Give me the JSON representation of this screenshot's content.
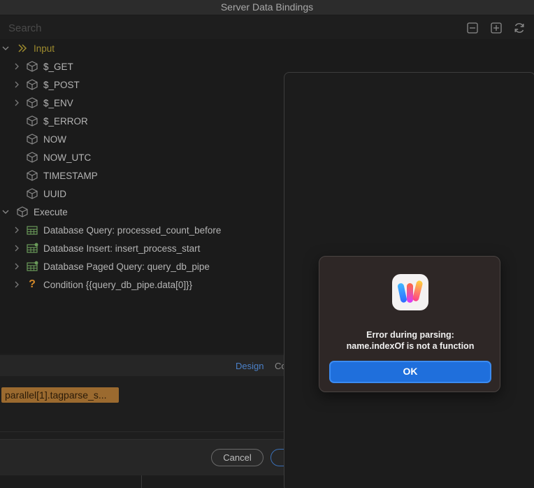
{
  "window": {
    "title": "Server Data Bindings"
  },
  "search": {
    "placeholder": "Search"
  },
  "toolbar": {
    "collapse_icon": "minus-square-icon",
    "expand_icon": "plus-square-icon",
    "refresh_icon": "refresh-icon"
  },
  "tree": {
    "input": {
      "label": "Input",
      "children": [
        "$_GET",
        "$_POST",
        "$_ENV",
        "$_ERROR",
        "NOW",
        "NOW_UTC",
        "TIMESTAMP",
        "UUID"
      ]
    },
    "execute": {
      "label": "Execute",
      "children": [
        "Database Query: processed_count_before",
        "Database Insert: insert_process_start",
        "Database Paged Query: query_db_pipe",
        "Condition {{query_db_pipe.data[0]}}"
      ]
    }
  },
  "tabs": {
    "design": "Design",
    "code": "Co"
  },
  "expression": {
    "chip": "parallel[1].tagparse_s..."
  },
  "footer": {
    "cancel": "Cancel"
  },
  "alert": {
    "title_line1": "Error during parsing:",
    "title_line2": "name.indexOf is not a function",
    "ok": "OK"
  },
  "colors": {
    "accent": "#1f6fdc",
    "input_label": "#9d8a2e",
    "chip": "#9b6a2f"
  }
}
